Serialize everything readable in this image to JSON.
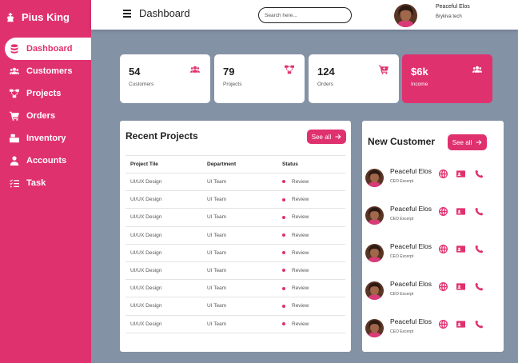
{
  "brand": {
    "name": "Pius King",
    "icon": "chess-king-icon"
  },
  "nav": [
    {
      "label": "Dashboard",
      "icon": "database-icon",
      "active": true
    },
    {
      "label": "Customers",
      "icon": "users-icon"
    },
    {
      "label": "Projects",
      "icon": "project-diagram-icon"
    },
    {
      "label": "Orders",
      "icon": "cart-icon"
    },
    {
      "label": "Inventory",
      "icon": "inventory-icon"
    },
    {
      "label": "Accounts",
      "icon": "user-icon"
    },
    {
      "label": "Task",
      "icon": "tasks-icon"
    }
  ],
  "topbar": {
    "title": "Dashboard",
    "menu_icon": "hamburger-icon",
    "search_placeholder": "Search here...",
    "user_name": "Peaceful Elos",
    "user_company": "Brykiva tech"
  },
  "stats": [
    {
      "value": "54",
      "label": "Customers",
      "icon": "users-icon"
    },
    {
      "value": "79",
      "label": "Projects",
      "icon": "project-diagram-icon"
    },
    {
      "value": "124",
      "label": "Orders",
      "icon": "cart-icon"
    },
    {
      "value": "$6k",
      "label": "Income",
      "icon": "users-icon",
      "accent": true
    }
  ],
  "recent_projects": {
    "title": "Recent Projects",
    "see_all": "See all",
    "columns": [
      "Project Tile",
      "Department",
      "Status"
    ],
    "rows": [
      [
        "UI/UX Design",
        "UI Team",
        "Review"
      ],
      [
        "UI/UX Design",
        "UI Team",
        "Review"
      ],
      [
        "UI/UX Design",
        "UI Team",
        "Review"
      ],
      [
        "UI/UX Design",
        "UI Team",
        "Review"
      ],
      [
        "UI/UX Design",
        "UI Team",
        "Review"
      ],
      [
        "UI/UX Design",
        "UI Team",
        "Review"
      ],
      [
        "UI/UX Design",
        "UI Team",
        "Review"
      ],
      [
        "UI/UX Design",
        "UI Team",
        "Review"
      ],
      [
        "UI/UX Design",
        "UI Team",
        "Review"
      ]
    ]
  },
  "new_customer": {
    "title": "New Customer",
    "see_all": "See all",
    "customers": [
      {
        "name": "Peaceful Elos",
        "title": "CEO Excerpt"
      },
      {
        "name": "Peaceful Elos",
        "title": "CEO Excerpt"
      },
      {
        "name": "Peaceful Elos",
        "title": "CEO Excerpt"
      },
      {
        "name": "Peaceful Elos",
        "title": "CEO Excerpt"
      },
      {
        "name": "Peaceful Elos",
        "title": "CEO Excerpt"
      }
    ]
  },
  "colors": {
    "accent": "#e0316f",
    "background": "#8492a6",
    "surface": "#ffffff"
  }
}
